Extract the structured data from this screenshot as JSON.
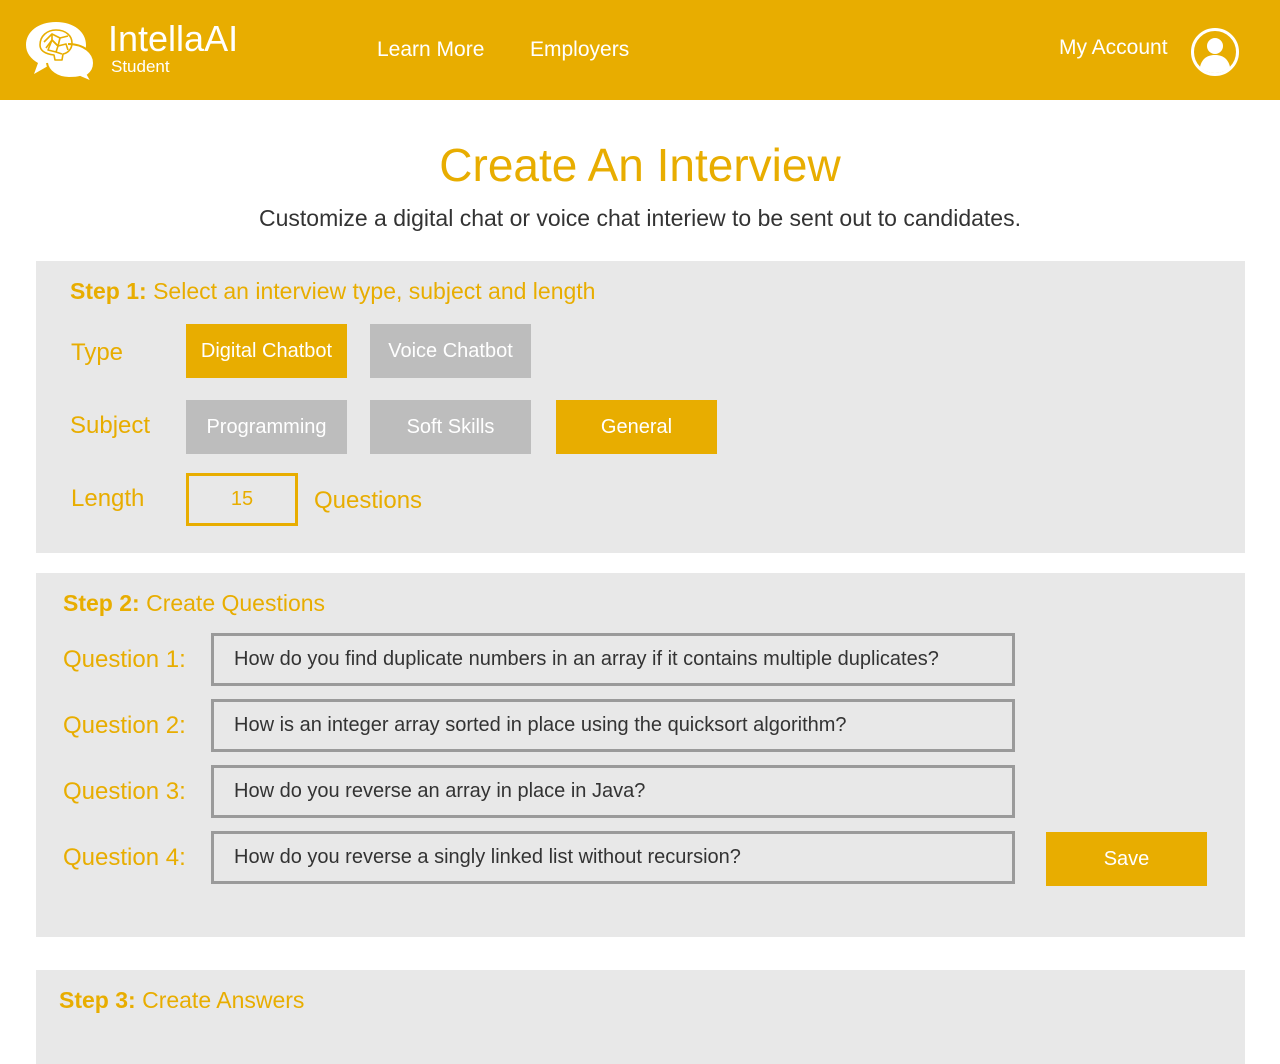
{
  "header": {
    "brand_name": "IntellaAI",
    "brand_sub": "Student",
    "nav": [
      "Learn More",
      "Employers"
    ],
    "account_label": "My Account",
    "logo_icon": "brain-chat-bubble-icon",
    "account_icon": "user-avatar-icon"
  },
  "page": {
    "title": "Create An Interview",
    "subtitle": "Customize a digital chat or voice chat interiew to be sent out to candidates."
  },
  "step1": {
    "step_label": "Step 1:",
    "heading": "Select an interview type, subject and length",
    "type_label": "Type",
    "type_options": [
      {
        "label": "Digital Chatbot",
        "selected": true
      },
      {
        "label": "Voice Chatbot",
        "selected": false
      }
    ],
    "subject_label": "Subject",
    "subject_options": [
      {
        "label": "Programming",
        "selected": false
      },
      {
        "label": "Soft Skills",
        "selected": false
      },
      {
        "label": "General",
        "selected": true
      }
    ],
    "length_label": "Length",
    "length_value": "15",
    "length_unit": "Questions"
  },
  "step2": {
    "step_label": "Step 2:",
    "heading": "Create Questions",
    "questions": [
      {
        "label": "Question 1:",
        "value": "How do you find duplicate numbers in an array if it contains multiple duplicates?"
      },
      {
        "label": "Question 2:",
        "value": "How is an integer array sorted in place using the quicksort algorithm?"
      },
      {
        "label": "Question 3:",
        "value": "How do you reverse an array in place in Java?"
      },
      {
        "label": "Question 4:",
        "value": "How do you reverse a singly linked list without recursion?"
      }
    ],
    "save_label": "Save"
  },
  "step3": {
    "step_label": "Step 3:",
    "heading": "Create Answers"
  },
  "colors": {
    "accent": "#e8ad00",
    "panel": "#e8e8e8",
    "chip_inactive": "#bdbdbd",
    "text": "#333333"
  }
}
